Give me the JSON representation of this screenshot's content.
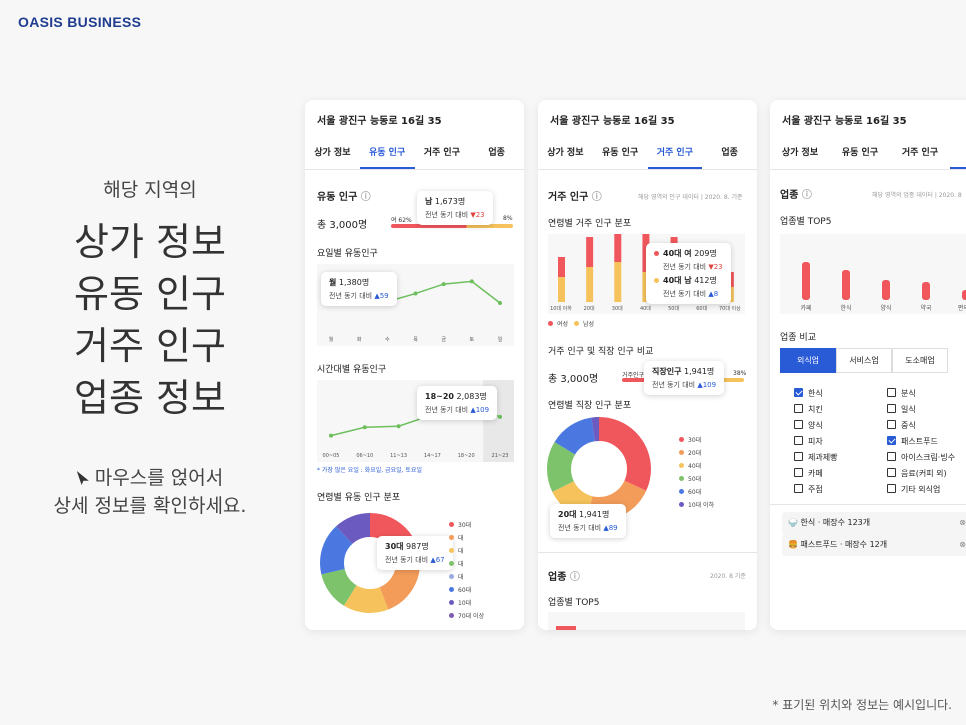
{
  "brand": "OASIS BUSINESS",
  "hero": {
    "sub": "해당 지역의",
    "lines": [
      "상가 정보",
      "유동 인구",
      "거주 인구",
      "업종 정보"
    ],
    "hint1": "마우스를 얹어서",
    "hint2": "상세 정보를 확인하세요."
  },
  "footnote": "* 표기된 위치와 정보는 예시입니다.",
  "address": "서울 광진구 능동로 16길 35",
  "tabs": [
    "상가 정보",
    "유동 인구",
    "거주 인구",
    "업종"
  ],
  "card1": {
    "section_title": "유동 인구",
    "total": "총 3,000명",
    "bar_left": "여 62%",
    "bar_right": "8%",
    "tip_top": {
      "name": "남",
      "value": "1,673명",
      "yoy": "전년 동기 대비",
      "delta": "▼23"
    },
    "weekday_title": "요일별 유동인구",
    "weekday_tip": {
      "name": "월",
      "value": "1,380명",
      "yoy": "전년 동기 대비",
      "delta": "▲59"
    },
    "days": [
      "월",
      "화",
      "수",
      "목",
      "금",
      "토",
      "일"
    ],
    "weekday_values": [
      1380,
      1100,
      1050,
      1350,
      1700,
      1800,
      1000
    ],
    "hourly_title": "시간대별 유동인구",
    "hours": [
      "00~05",
      "06~10",
      "11~13",
      "14~17",
      "18~20",
      "21~23"
    ],
    "hourly_values": [
      500,
      900,
      950,
      1500,
      2083,
      1400
    ],
    "hourly_tip": {
      "name": "18~20",
      "value": "2,083명",
      "yoy": "전년 동기 대비",
      "delta": "▲109"
    },
    "hourly_note": "* 가장 많은 요일 : 화요일, 금요일, 토요일",
    "age_title": "연령별 유동 인구 분포",
    "age_tip": {
      "name": "30대",
      "value": "987명",
      "yoy": "전년 동기 대비",
      "delta": "▲67"
    },
    "age_legend": [
      "30대",
      "대",
      "대",
      "대",
      "대",
      "60대",
      "10대",
      "70대 이상"
    ]
  },
  "card2": {
    "section_title": "거주 인구",
    "ref": "해당 영역의 인구 데이터 | 2020. 8. 기준",
    "dist_title": "연령별 거주 인구 분포",
    "bar_cats": [
      "10대 이하",
      "20대",
      "30대",
      "40대",
      "50대",
      "60대",
      "70대 이상"
    ],
    "female": [
      20,
      30,
      45,
      40,
      35,
      25,
      15
    ],
    "male": [
      25,
      35,
      40,
      30,
      30,
      20,
      15
    ],
    "tip": {
      "f_name": "40대 여",
      "f_value": "209명",
      "f_yoy": "전년 동기 대비",
      "f_delta": "▼23",
      "m_name": "40대 남",
      "m_value": "412명",
      "m_yoy": "전년 동기 대비",
      "m_delta": "▲8"
    },
    "legend_f": "여성",
    "legend_m": "남성",
    "compare_title": "거주 인구 및 직장 인구 비교",
    "compare_total": "총 3,000명",
    "compare_left": "거주인구",
    "compare_right": "38%",
    "compare_tip": {
      "name": "직장인구",
      "value": "1,941명",
      "yoy": "전년 동기 대비",
      "delta": "▲109"
    },
    "work_title": "연령별 직장 인구 분포",
    "work_tip": {
      "name": "20대",
      "value": "1,941명",
      "yoy": "전년 동기 대비",
      "delta": "▲89"
    },
    "work_legend": [
      "30대",
      "20대",
      "40대",
      "50대",
      "60대",
      "10대 이하"
    ],
    "biz_title": "업종",
    "biz_ref": "2020. 8 기준",
    "biz_top": "업종별 TOP5"
  },
  "card3": {
    "section_title": "업종",
    "ref": "해당 영역의 업종 데이터 | 2020. 8",
    "top_title": "업종별 TOP5",
    "top_cats": [
      "카페",
      "한식",
      "양식",
      "약국",
      "편의점"
    ],
    "top_values": [
      38,
      30,
      20,
      18,
      10
    ],
    "compare_title": "업종 비교",
    "segments": [
      "외식업",
      "서비스업",
      "도소매업"
    ],
    "checks_left": [
      "한식",
      "치킨",
      "양식",
      "피자",
      "제과제빵",
      "카페",
      "주점"
    ],
    "checks_right": [
      "분식",
      "일식",
      "중식",
      "패스트푸드",
      "아이스크림·빙수",
      "음료(커피 외)",
      "기타 외식업"
    ],
    "row1": "한식 · 매장수 123개",
    "row2": "패스트푸드 · 매장수 12개"
  },
  "colors": {
    "accent": "#2a5bd7",
    "red": "#f0575c",
    "yellow": "#f5c25b",
    "green": "#7cc36b",
    "blue": "#4a78e0",
    "purple": "#6b5bc0",
    "orange": "#f39c5a"
  }
}
